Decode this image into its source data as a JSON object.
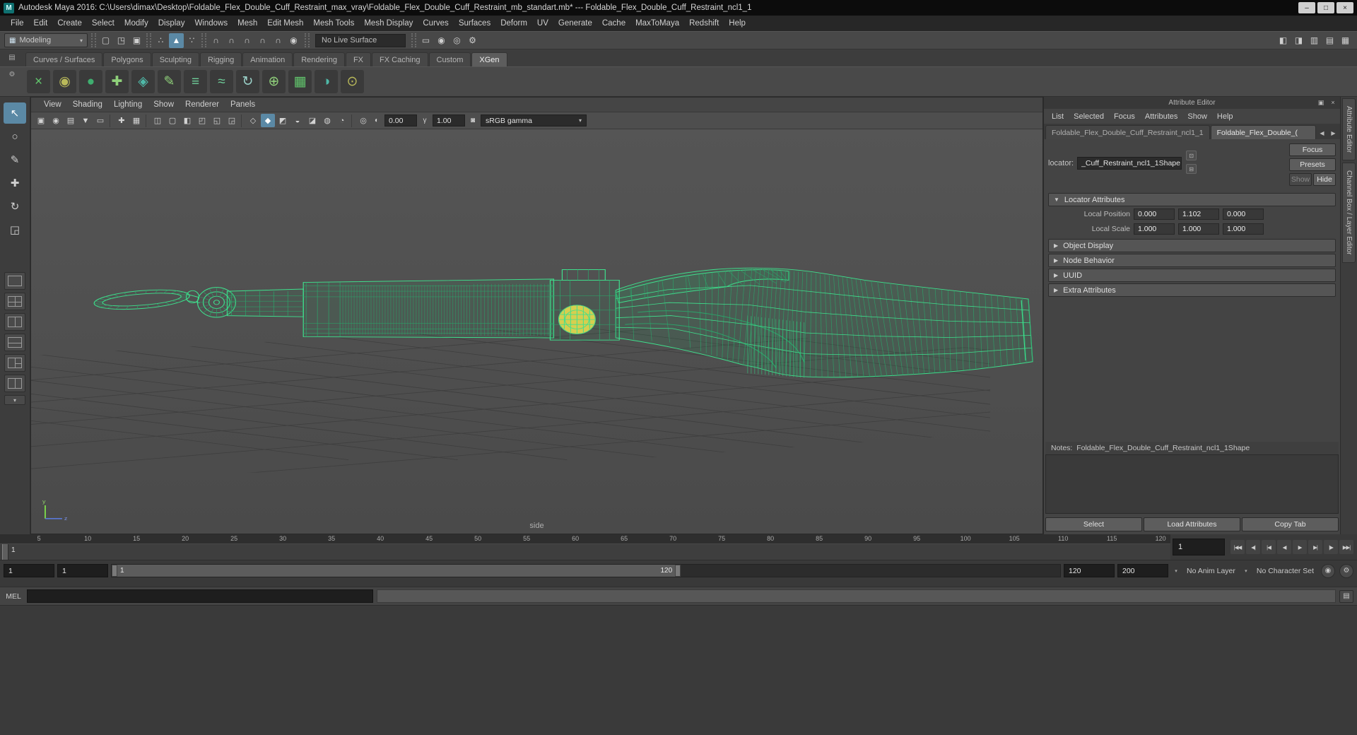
{
  "colors": {
    "accent": "#5b89a5",
    "wireframe": "#3fe08d",
    "manipulator": "#d6ce4f"
  },
  "window": {
    "title": "Autodesk Maya 2016: C:\\Users\\dimax\\Desktop\\Foldable_Flex_Double_Cuff_Restraint_max_vray\\Foldable_Flex_Double_Cuff_Restraint_mb_standart.mb*   ---  Foldable_Flex_Double_Cuff_Restraint_ncl1_1",
    "controls": [
      {
        "name": "minimize-button",
        "glyph": "–"
      },
      {
        "name": "maximize-button",
        "glyph": "□"
      },
      {
        "name": "close-button",
        "glyph": "×"
      }
    ]
  },
  "menu_bar": [
    "File",
    "Edit",
    "Create",
    "Select",
    "Modify",
    "Display",
    "Windows",
    "Mesh",
    "Edit Mesh",
    "Mesh Tools",
    "Mesh Display",
    "Curves",
    "Surfaces",
    "Deform",
    "UV",
    "Generate",
    "Cache",
    "MaxToMaya",
    "Redshift",
    "Help"
  ],
  "status_line": {
    "menu_set": "Modeling",
    "live_surface": "No Live Surface",
    "groups_left": [
      [
        {
          "name": "scene-new-icon",
          "glyph": "▢"
        },
        {
          "name": "scene-open-icon",
          "glyph": "◳"
        },
        {
          "name": "scene-save-icon",
          "glyph": "▣"
        }
      ],
      [
        {
          "name": "select-hierarchy-icon",
          "glyph": "∴"
        },
        {
          "name": "select-object-icon",
          "glyph": "▲",
          "active": true
        },
        {
          "name": "select-component-icon",
          "glyph": "∵"
        }
      ],
      [
        {
          "name": "snap-to-grid-icon",
          "glyph": "∩"
        },
        {
          "name": "snap-to-curve-icon",
          "glyph": "∩"
        },
        {
          "name": "snap-to-point-icon",
          "glyph": "∩"
        },
        {
          "name": "snap-to-projected-center-icon",
          "glyph": "∩"
        },
        {
          "name": "snap-to-view-plane-icon",
          "glyph": "∩"
        },
        {
          "name": "make-live-icon",
          "glyph": "◉"
        }
      ]
    ],
    "groups_right": [
      [
        {
          "name": "render-view-icon",
          "glyph": "▭"
        },
        {
          "name": "render-current-frame-icon",
          "glyph": "◉"
        },
        {
          "name": "ipr-render-icon",
          "glyph": "◎"
        },
        {
          "name": "render-settings-icon",
          "glyph": "⚙"
        }
      ]
    ],
    "right_icons": [
      {
        "name": "modeling-toolkit-toggle-icon",
        "glyph": "◧"
      },
      {
        "name": "humanik-toggle-icon",
        "glyph": "◨"
      },
      {
        "name": "attribute-editor-toggle-icon",
        "glyph": "▥"
      },
      {
        "name": "tool-settings-toggle-icon",
        "glyph": "▤"
      },
      {
        "name": "channel-box-toggle-icon",
        "glyph": "▦"
      }
    ]
  },
  "shelf": {
    "tabs": [
      "Curves / Surfaces",
      "Polygons",
      "Sculpting",
      "Rigging",
      "Animation",
      "Rendering",
      "FX",
      "FX Caching",
      "Custom",
      "XGen"
    ],
    "active_tab": "XGen",
    "icons": [
      {
        "name": "xgen-create-description-icon",
        "glyph": "×",
        "color": "#62c76d"
      },
      {
        "name": "xgen-description-editor-icon",
        "glyph": "◉",
        "color": "#b9b95a"
      },
      {
        "name": "xgen-preview-icon",
        "glyph": "●",
        "color": "#3fae6f"
      },
      {
        "name": "xgen-add-guide-icon",
        "glyph": "✚",
        "color": "#8fd07a"
      },
      {
        "name": "xgen-move-guide-icon",
        "glyph": "◈",
        "color": "#4fb9a8"
      },
      {
        "name": "xgen-sculpt-brush-icon",
        "glyph": "✎",
        "color": "#8fd07a"
      },
      {
        "name": "xgen-comb-brush-icon",
        "glyph": "≡",
        "color": "#6fcf9a"
      },
      {
        "name": "xgen-length-brush-icon",
        "glyph": "≈",
        "color": "#6fcf9a"
      },
      {
        "name": "xgen-rotate-brush-icon",
        "glyph": "↻",
        "color": "#9ad0c8"
      },
      {
        "name": "xgen-convert-icon",
        "glyph": "⊕",
        "color": "#8fd07a"
      },
      {
        "name": "xgen-export-patches-icon",
        "glyph": "▦",
        "color": "#62c76d"
      },
      {
        "name": "xgen-import-preset-icon",
        "glyph": "◑",
        "color": "#4fb9a8"
      },
      {
        "name": "xgen-editor-icon",
        "glyph": "⊙",
        "color": "#b9b95a"
      }
    ]
  },
  "toolbox": {
    "tools": [
      {
        "name": "select-tool",
        "glyph": "↖",
        "active": true
      },
      {
        "name": "lasso-select-tool",
        "glyph": "○"
      },
      {
        "name": "paint-select-tool",
        "glyph": "✎"
      },
      {
        "name": "move-tool",
        "glyph": "✚"
      },
      {
        "name": "rotate-tool",
        "glyph": "↻"
      },
      {
        "name": "scale-tool",
        "glyph": "◲"
      }
    ],
    "layouts": [
      {
        "name": "layout-single-pane-button",
        "type": "single"
      },
      {
        "name": "layout-four-pane-button",
        "type": "four"
      },
      {
        "name": "layout-two-pane-side-button",
        "type": "two-v"
      },
      {
        "name": "layout-two-pane-stacked-button",
        "type": "two-h"
      },
      {
        "name": "layout-three-pane-button",
        "type": "three"
      },
      {
        "name": "layout-outliner-persp-button",
        "type": "two-v"
      },
      {
        "name": "layout-menu-button",
        "type": "menu"
      }
    ]
  },
  "viewport": {
    "menus": [
      "View",
      "Shading",
      "Lighting",
      "Show",
      "Renderer",
      "Panels"
    ],
    "toolbar_icons": [
      {
        "name": "select-camera-icon",
        "glyph": "▣"
      },
      {
        "name": "lock-camera-icon",
        "glyph": "◉"
      },
      {
        "name": "camera-attributes-icon",
        "glyph": "▤"
      },
      {
        "name": "bookmarks-icon",
        "glyph": "▼"
      },
      {
        "name": "image-plane-icon",
        "glyph": "▭"
      },
      {
        "sep": true
      },
      {
        "name": "2d-pan-zoom-icon",
        "glyph": "✚"
      },
      {
        "name": "oversampling-icon",
        "glyph": "▦"
      },
      {
        "sep": true
      },
      {
        "name": "film-gate-icon",
        "glyph": "◫"
      },
      {
        "name": "resolution-gate-icon",
        "glyph": "▢"
      },
      {
        "name": "gate-mask-icon",
        "glyph": "◧"
      },
      {
        "name": "field-chart-icon",
        "glyph": "◰"
      },
      {
        "name": "safe-action-icon",
        "glyph": "◱"
      },
      {
        "name": "safe-title-icon",
        "glyph": "◲"
      },
      {
        "sep": true
      },
      {
        "name": "wireframe-display-icon",
        "glyph": "◇"
      },
      {
        "name": "shaded-display-icon",
        "glyph": "◆",
        "active": true
      },
      {
        "name": "textured-display-icon",
        "glyph": "◩"
      },
      {
        "name": "use-all-lights-icon",
        "glyph": "◒"
      },
      {
        "name": "shadows-icon",
        "glyph": "◪"
      },
      {
        "name": "screen-space-ao-icon",
        "glyph": "◍"
      },
      {
        "name": "motion-blur-icon",
        "glyph": "◔"
      },
      {
        "sep": true
      },
      {
        "name": "isolate-select-icon",
        "glyph": "◎"
      }
    ],
    "exposure": "0.00",
    "gamma": "1.00",
    "color_space": "sRGB gamma",
    "camera_label": "side"
  },
  "attribute_editor": {
    "title": "Attribute Editor",
    "menus": [
      "List",
      "Selected",
      "Focus",
      "Attributes",
      "Show",
      "Help"
    ],
    "tabs": [
      "Foldable_Flex_Double_Cuff_Restraint_ncl1_1",
      "Foldable_Flex_Double_("
    ],
    "locator_label": "locator:",
    "locator_value": "_Cuff_Restraint_ncl1_1Shape",
    "focus_btn": "Focus",
    "presets_btn": "Presets",
    "show_btn": "Show",
    "hide_btn": "Hide",
    "locator_section": "Locator Attributes",
    "collapsed_sections": [
      "Object Display",
      "Node Behavior",
      "UUID",
      "Extra Attributes"
    ],
    "local_position": {
      "label": "Local Position",
      "x": "0.000",
      "y": "1.102",
      "z": "0.000"
    },
    "local_scale": {
      "label": "Local Scale",
      "x": "1.000",
      "y": "1.000",
      "z": "1.000"
    },
    "notes_label": "Notes:",
    "notes_value": "Foldable_Flex_Double_Cuff_Restraint_ncl1_1Shape",
    "buttons": [
      "Select",
      "Load Attributes",
      "Copy Tab"
    ]
  },
  "side_tabs": [
    "Attribute Editor",
    "Channel Box / Layer Editor"
  ],
  "timeline": {
    "ticks": [
      5,
      10,
      15,
      20,
      25,
      30,
      35,
      40,
      45,
      50,
      55,
      60,
      65,
      70,
      75,
      80,
      85,
      90,
      95,
      100,
      105,
      110,
      115,
      120
    ],
    "range_shown": [
      1,
      121
    ],
    "current_frame": "1",
    "current_time": "1",
    "playback": [
      {
        "name": "go-to-start-button",
        "glyph": "|◀◀"
      },
      {
        "name": "step-back-one-frame-button",
        "glyph": "◀|"
      },
      {
        "name": "step-back-one-key-button",
        "glyph": "|◀"
      },
      {
        "name": "play-backwards-button",
        "glyph": "◀"
      },
      {
        "name": "play-forwards-button",
        "glyph": "▶"
      },
      {
        "name": "step-forward-one-key-button",
        "glyph": "▶|"
      },
      {
        "name": "step-forward-one-frame-button",
        "glyph": "|▶"
      },
      {
        "name": "go-to-end-button",
        "glyph": "▶▶|"
      }
    ]
  },
  "range_slider": {
    "anim_start": "1",
    "playback_start": "1",
    "inner_start": "1",
    "inner_end": "120",
    "playback_end": "120",
    "anim_end": "200",
    "range_fraction": 0.6,
    "anim_layer": "No Anim Layer",
    "character_set": "No Character Set"
  },
  "command_line": {
    "label": "MEL"
  }
}
